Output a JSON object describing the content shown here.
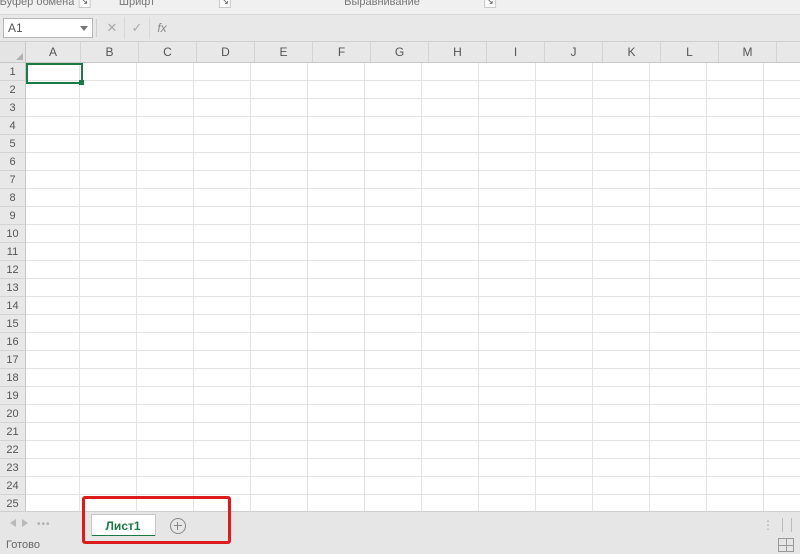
{
  "ribbon_groups": {
    "clipboard": "Буфер обмена",
    "font": "Шрифт",
    "alignment": "Выравнивание"
  },
  "name_box": {
    "value": "A1"
  },
  "formula_bar": {
    "fx_label": "fx",
    "cancel_glyph": "✕",
    "confirm_glyph": "✓",
    "value": ""
  },
  "columns": [
    "A",
    "B",
    "C",
    "D",
    "E",
    "F",
    "G",
    "H",
    "I",
    "J",
    "K",
    "L",
    "M"
  ],
  "rows": [
    1,
    2,
    3,
    4,
    5,
    6,
    7,
    8,
    9,
    10,
    11,
    12,
    13,
    14,
    15,
    16,
    17,
    18,
    19,
    20,
    21,
    22,
    23,
    24,
    25
  ],
  "selected_cell": "A1",
  "sheet_tabs": {
    "active": "Лист1",
    "add_tooltip": "+"
  },
  "status": {
    "ready": "Готово"
  }
}
